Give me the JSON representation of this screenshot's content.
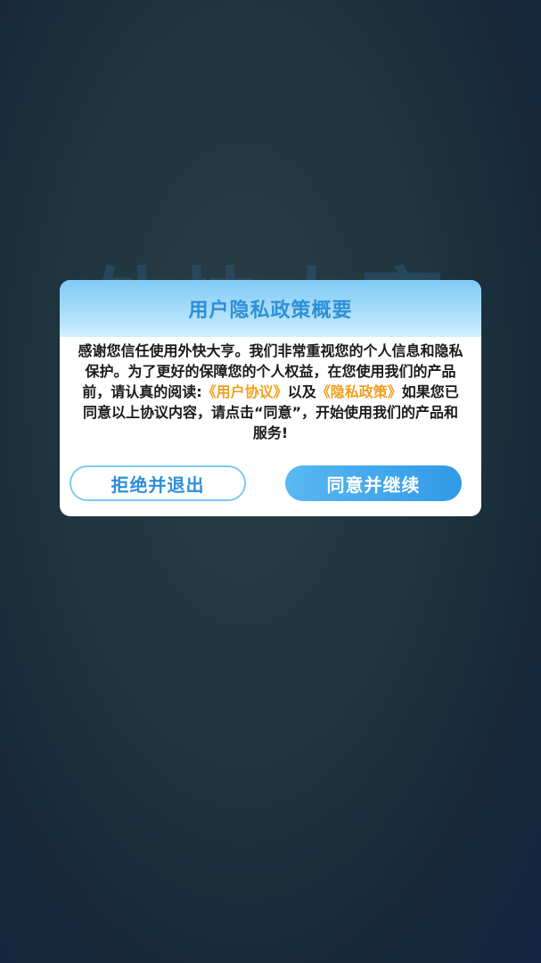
{
  "background": {
    "app_name": "外快大亨"
  },
  "dialog": {
    "title": "用户隐私政策概要",
    "body": {
      "part1": "感谢您信任使用外快大亨。我们非常重视您的个人信息和隐私保护。为了更好的保障您的个人权益，在您使用我们的产品前，请认真的阅读:",
      "user_agreement_link": "《用户协议》",
      "conjunction": "以及",
      "privacy_policy_link": "《隐私政策》",
      "part2": "如果您已同意以上协议内容，请点击“同意”，开始使用我们的产品和服务!"
    },
    "decline_label": "拒绝并退出",
    "agree_label": "同意并继续"
  },
  "colors": {
    "accent": "#2f8fd8",
    "link": "#f0a020",
    "agree_button": "#3199e6"
  }
}
